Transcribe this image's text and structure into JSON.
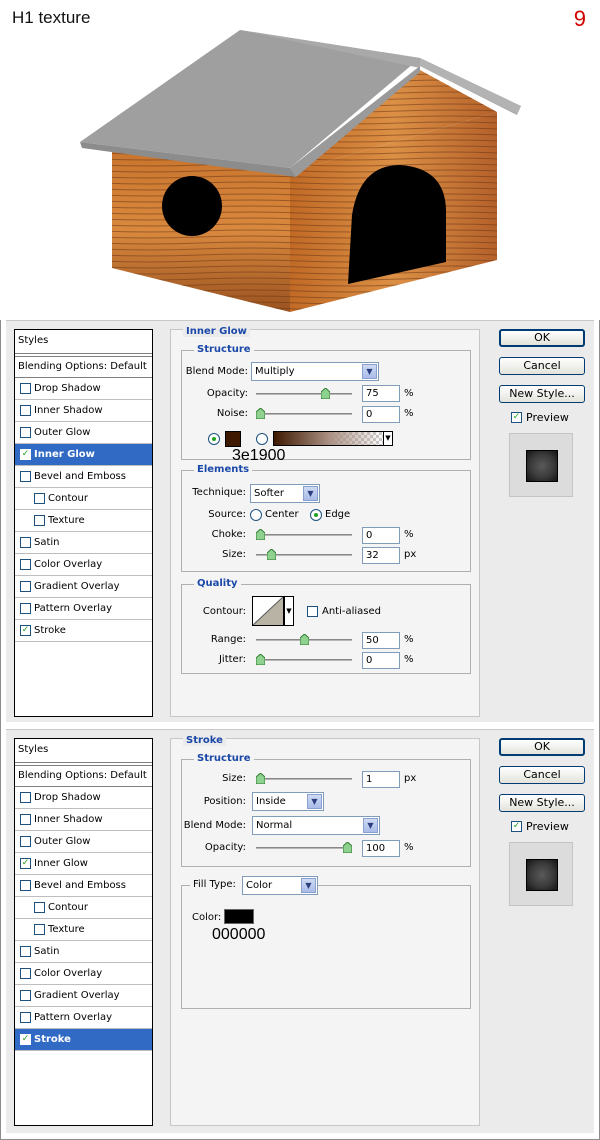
{
  "hero": {
    "title": "H1 texture",
    "step": "9"
  },
  "styles_header": "Styles",
  "blending_options": "Blending Options: Default",
  "dialog1": {
    "items": [
      {
        "label": "Drop Shadow",
        "checked": false,
        "sub": false,
        "selected": false
      },
      {
        "label": "Inner Shadow",
        "checked": false,
        "sub": false,
        "selected": false
      },
      {
        "label": "Outer Glow",
        "checked": false,
        "sub": false,
        "selected": false
      },
      {
        "label": "Inner Glow",
        "checked": true,
        "sub": false,
        "selected": true
      },
      {
        "label": "Bevel and Emboss",
        "checked": false,
        "sub": false,
        "selected": false
      },
      {
        "label": "Contour",
        "checked": false,
        "sub": true,
        "selected": false
      },
      {
        "label": "Texture",
        "checked": false,
        "sub": true,
        "selected": false
      },
      {
        "label": "Satin",
        "checked": false,
        "sub": false,
        "selected": false
      },
      {
        "label": "Color Overlay",
        "checked": false,
        "sub": false,
        "selected": false
      },
      {
        "label": "Gradient Overlay",
        "checked": false,
        "sub": false,
        "selected": false
      },
      {
        "label": "Pattern Overlay",
        "checked": false,
        "sub": false,
        "selected": false
      },
      {
        "label": "Stroke",
        "checked": true,
        "sub": false,
        "selected": false
      }
    ],
    "section": "Inner Glow",
    "structure": {
      "title": "Structure",
      "blend_mode_label": "Blend Mode:",
      "blend_mode": "Multiply",
      "opacity_label": "Opacity:",
      "opacity": "75",
      "opacity_fraction": 0.75,
      "noise_label": "Noise:",
      "noise": "0",
      "noise_fraction": 0,
      "percent": "%",
      "color_hex": "#3e1900",
      "color_code": "3e1900"
    },
    "elements": {
      "title": "Elements",
      "technique_label": "Technique:",
      "technique": "Softer",
      "source_label": "Source:",
      "center": "Center",
      "edge": "Edge",
      "choke_label": "Choke:",
      "choke": "0",
      "choke_fraction": 0,
      "size_label": "Size:",
      "size": "32",
      "size_fraction": 0.13,
      "px": "px",
      "percent": "%"
    },
    "quality": {
      "title": "Quality",
      "contour_label": "Contour:",
      "anti_aliased": "Anti-aliased",
      "range_label": "Range:",
      "range": "50",
      "range_fraction": 0.5,
      "jitter_label": "Jitter:",
      "jitter": "0",
      "jitter_fraction": 0,
      "percent": "%"
    }
  },
  "dialog2": {
    "items": [
      {
        "label": "Drop Shadow",
        "checked": false,
        "sub": false,
        "selected": false
      },
      {
        "label": "Inner Shadow",
        "checked": false,
        "sub": false,
        "selected": false
      },
      {
        "label": "Outer Glow",
        "checked": false,
        "sub": false,
        "selected": false
      },
      {
        "label": "Inner Glow",
        "checked": true,
        "sub": false,
        "selected": false
      },
      {
        "label": "Bevel and Emboss",
        "checked": false,
        "sub": false,
        "selected": false
      },
      {
        "label": "Contour",
        "checked": false,
        "sub": true,
        "selected": false
      },
      {
        "label": "Texture",
        "checked": false,
        "sub": true,
        "selected": false
      },
      {
        "label": "Satin",
        "checked": false,
        "sub": false,
        "selected": false
      },
      {
        "label": "Color Overlay",
        "checked": false,
        "sub": false,
        "selected": false
      },
      {
        "label": "Gradient Overlay",
        "checked": false,
        "sub": false,
        "selected": false
      },
      {
        "label": "Pattern Overlay",
        "checked": false,
        "sub": false,
        "selected": false
      },
      {
        "label": "Stroke",
        "checked": true,
        "sub": false,
        "selected": true
      }
    ],
    "section": "Stroke",
    "structure": {
      "title": "Structure",
      "size_label": "Size:",
      "size": "1",
      "size_fraction": 0,
      "px": "px",
      "position_label": "Position:",
      "position": "Inside",
      "blend_mode_label": "Blend Mode:",
      "blend_mode": "Normal",
      "opacity_label": "Opacity:",
      "opacity": "100",
      "opacity_fraction": 1,
      "percent": "%"
    },
    "fill": {
      "fill_type_label": "Fill Type:",
      "fill_type": "Color",
      "color_label": "Color:",
      "color_hex": "#000000",
      "color_code": "000000"
    }
  },
  "buttons": {
    "ok": "OK",
    "cancel": "Cancel",
    "new_style": "New Style...",
    "preview": "Preview"
  }
}
